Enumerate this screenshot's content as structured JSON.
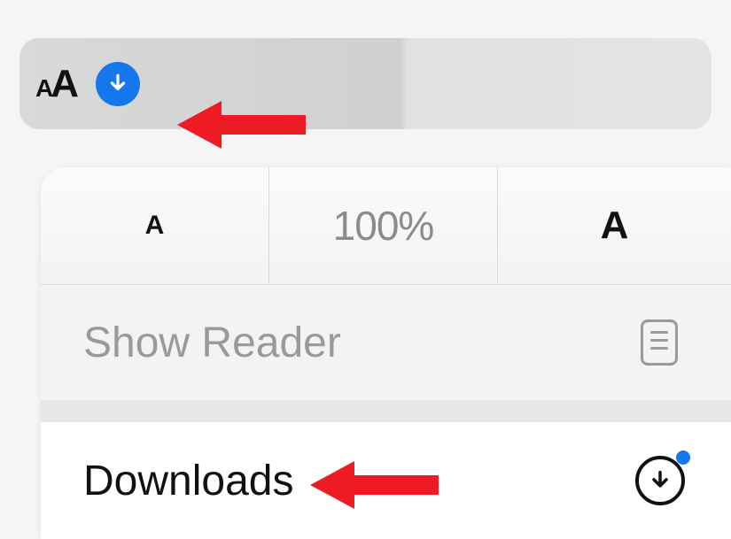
{
  "addressBar": {
    "aaSmall": "A",
    "aaBig": "A"
  },
  "zoom": {
    "smallA": "A",
    "percent": "100%",
    "bigA": "A"
  },
  "menu": {
    "showReader": "Show Reader",
    "downloads": "Downloads"
  },
  "icons": {
    "downloadBadge": "download-arrow",
    "readerPage": "reader-page",
    "downloadsCircle": "download-circle",
    "indicatorDot": "blue-dot"
  },
  "annotations": {
    "arrow1": "red-arrow",
    "arrow2": "red-arrow"
  }
}
